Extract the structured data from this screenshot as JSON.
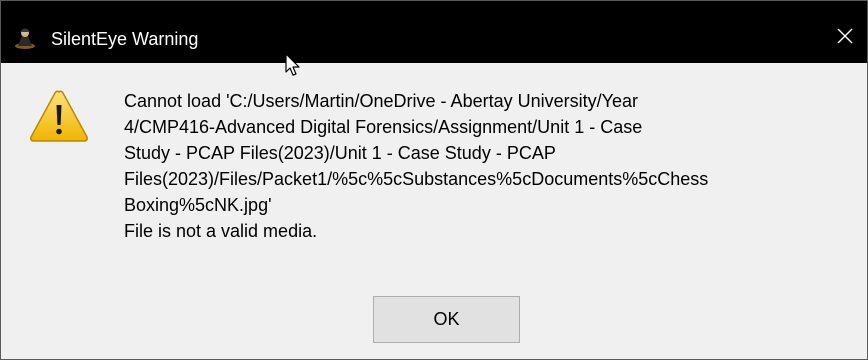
{
  "window": {
    "title": "SilentEye Warning"
  },
  "dialog": {
    "message_lines": [
      "Cannot load 'C:/Users/Martin/OneDrive - Abertay University/Year",
      "4/CMP416-Advanced Digital Forensics/Assignment/Unit 1 - Case",
      "Study - PCAP Files(2023)/Unit 1 - Case Study - PCAP",
      "Files(2023)/Files/Packet1/%5c%5cSubstances%5cDocuments%5cChess",
      "Boxing%5cNK.jpg'",
      "File is not a valid media."
    ],
    "ok_label": "OK"
  },
  "icons": {
    "app": "silenteye-app-icon",
    "warning": "warning-triangle-icon",
    "close": "close-icon",
    "cursor": "mouse-pointer-icon"
  },
  "colors": {
    "titlebar": "#000000",
    "title_text": "#ffffff",
    "dialog_background": "#f0f0f0",
    "warning_fill": "#f5c400",
    "button_background": "#e1e1e1"
  }
}
